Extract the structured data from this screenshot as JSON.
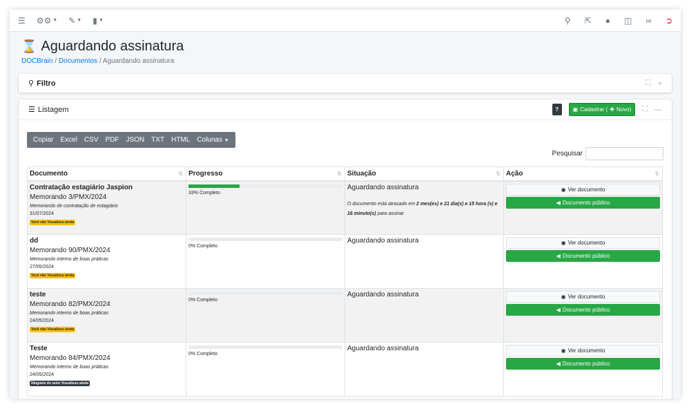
{
  "topbar": {
    "left_icons": [
      "bars-icon",
      "cogs-icon",
      "edit-icon",
      "file-icon"
    ],
    "right_icons": [
      "search-icon",
      "expand-icon",
      "comments-icon",
      "copy-icon",
      "link-icon",
      "logout-icon"
    ]
  },
  "header": {
    "title": "Aguardando assinatura",
    "breadcrumb": {
      "home": "DOCBrain",
      "section": "Documentos",
      "current": "Aguardando assinatura",
      "sep": "/"
    }
  },
  "filtro": {
    "title": "Filtro"
  },
  "listagem": {
    "title": "Listagem",
    "help_label": "?",
    "cadastrar_label": "Cadastrar (",
    "novo_label": "Novo)",
    "export_buttons": [
      "Copiar",
      "Excel",
      "CSV",
      "PDF",
      "JSON",
      "TXT",
      "HTML",
      "Colunas"
    ],
    "search_label": "Pesquisar",
    "search_value": ""
  },
  "table": {
    "columns": [
      "Documento",
      "Progresso",
      "Situação",
      "Ação"
    ],
    "ver_label": "Ver documento",
    "publico_label": "Documento público",
    "rows": [
      {
        "title": "Contratação estagiário Jaspion",
        "number": "Memorando 3/PMX/2024",
        "description": "Memorando de contratação de estagiário",
        "date": "31/07/2024",
        "badge": "Você não Visualizou ainda",
        "progress": 0.33,
        "progress_label": "33% Completo",
        "status": "Aguardando assinatura",
        "note_pre": "O documento está atrasado em ",
        "note_bold": "2 mes(es) e 21 dia(s) e 15 hora (s) e 16 minuto(s)",
        "note_post": " para assinar"
      },
      {
        "title": "dd",
        "number": "Memorando 90/PMX/2024",
        "description": "Memorando interno de boas práticas",
        "date": "27/05/2024",
        "badge": "Você não Visualizou ainda",
        "progress": 0,
        "progress_label": "0% Completo",
        "status": "Aguardando assinatura"
      },
      {
        "title": "teste",
        "number": "Memorando 82/PMX/2024",
        "description": "Memorando interno de boas práticas",
        "date": "24/05/2024",
        "badge": "Você não Visualizou ainda",
        "progress": 0,
        "progress_label": "0% Completo",
        "status": "Aguardando assinatura"
      },
      {
        "title": "Teste",
        "number": "Memorando 84/PMX/2024",
        "description": "Memorando interno de boas práticas",
        "date": "24/05/2024",
        "badge": "Ninguém do setor Visualizou ainda",
        "progress": 0,
        "progress_label": "0% Completo",
        "status": "Aguardando assinatura"
      }
    ]
  },
  "colors": {
    "success": "#28a745",
    "warning": "#ffc107",
    "dark": "#343a40",
    "secondary": "#6c757d",
    "danger": "#dc3545"
  }
}
